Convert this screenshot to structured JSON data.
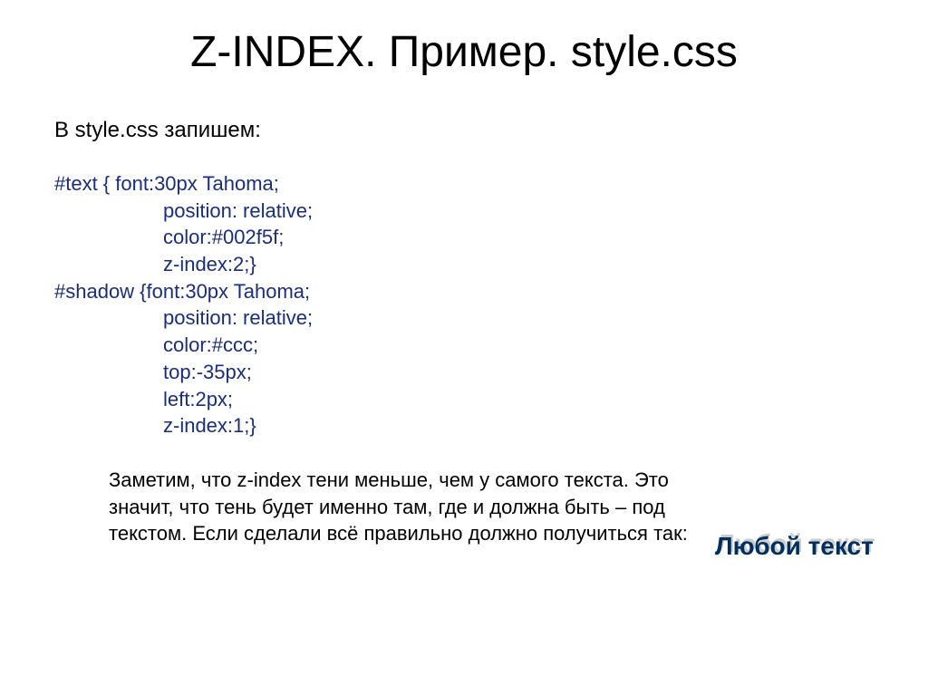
{
  "slide": {
    "title": "Z-INDEX. Пример. style.css",
    "intro": "В style.css запишем:",
    "code": {
      "sel1": "#text { font:30px Tahoma;",
      "l1a": "position: relative;",
      "l1b": "color:#002f5f;",
      "l1c": "z-index:2;}",
      "sel2": "#shadow {font:30px Tahoma;",
      "l2a": "position: relative;",
      "l2b": "color:#ccc;",
      "l2c": "top:-35px;",
      "l2d": "left:2px;",
      "l2e": "z-index:1;}"
    },
    "paragraph": "Заметим, что z-index тени меньше, чем у самого текста. Это значит, что тень будет именно там, где и должна быть – под текстом. Если сделали всё правильно должно получиться так:",
    "demo_text": "Любой текст"
  }
}
